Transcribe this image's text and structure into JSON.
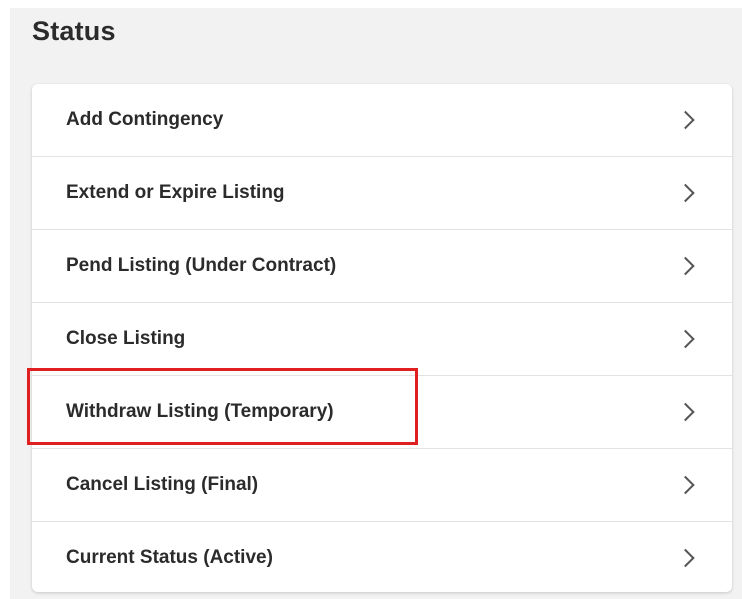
{
  "status_panel": {
    "title": "Status",
    "items": [
      {
        "label": "Add Contingency"
      },
      {
        "label": "Extend or Expire Listing"
      },
      {
        "label": "Pend Listing (Under Contract)"
      },
      {
        "label": "Close Listing"
      },
      {
        "label": "Withdraw Listing (Temporary)",
        "highlighted": true
      },
      {
        "label": "Cancel Listing (Final)"
      },
      {
        "label": "Current Status (Active)"
      }
    ]
  },
  "colors": {
    "panel_background": "#f2f2f2",
    "card_background": "#ffffff",
    "text": "#2b2b2b",
    "highlight_border": "#e02020"
  }
}
